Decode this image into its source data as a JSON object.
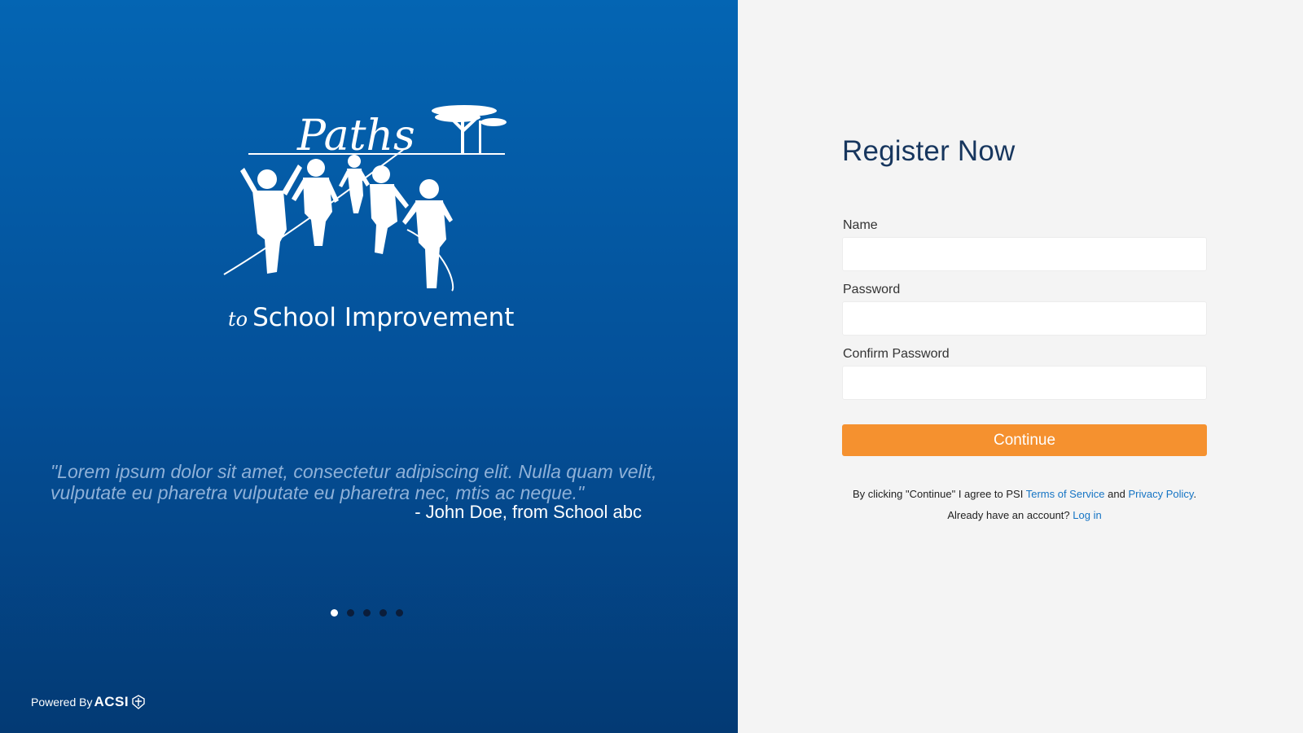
{
  "left_panel": {
    "logo_title": "Paths",
    "logo_subtitle_prefix": "to",
    "logo_subtitle": "School Improvement",
    "quote": "\"Lorem ipsum dolor sit amet, consectetur adipiscing elit. Nulla quam velit, vulputate eu pharetra vulputate eu pharetra nec, mtis ac neque.\"",
    "attribution": "- John Doe, from School abc",
    "carousel_dot_count": 5,
    "carousel_active_index": 0,
    "powered_by_label": "Powered By",
    "powered_by_brand": "ACSI"
  },
  "form": {
    "title": "Register Now",
    "name_label": "Name",
    "name_value": "",
    "password_label": "Password",
    "password_value": "",
    "confirm_label": "Confirm Password",
    "confirm_value": "",
    "continue_label": "Continue",
    "terms_prefix": "By clicking \"Continue\" I agree to PSI",
    "terms_link": "Terms of Service",
    "terms_and": "and",
    "privacy_link": "Privacy Policy",
    "terms_suffix": ".",
    "account_prompt": "Already have an account?",
    "login_link": "Log in"
  },
  "colors": {
    "panel_blue": "#0465b3",
    "title_navy": "#17365e",
    "button_orange": "#f5912f",
    "link_blue": "#1574c4",
    "form_bg": "#f4f4f4"
  },
  "icons": {
    "logo": "paths-logo-children-tree",
    "brand_mark": "acsi-emblem-icon"
  }
}
